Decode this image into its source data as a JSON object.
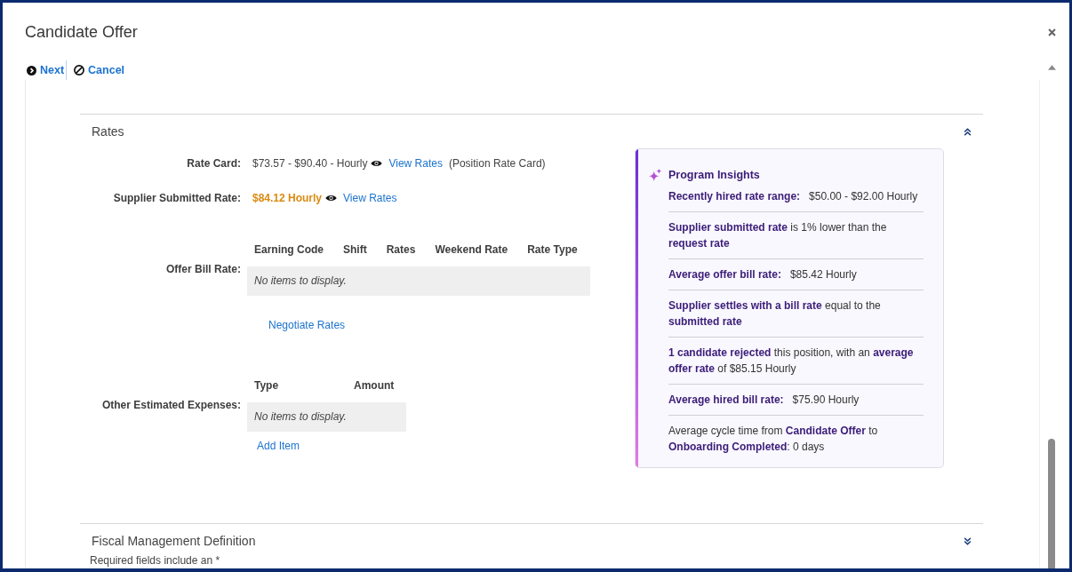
{
  "dialog": {
    "title": "Candidate Offer"
  },
  "toolbar": [
    {
      "kind": "next",
      "label": "Next"
    },
    {
      "kind": "cancel",
      "label": "Cancel"
    }
  ],
  "sections": [
    {
      "title": "Rates",
      "expanded": true,
      "fields": [
        {
          "kind": "rate",
          "label": "Rate Card:",
          "value": "$73.57 - $90.40 - Hourly",
          "highlighted": false,
          "link": "View Rates",
          "note": "(Position Rate Card)"
        },
        {
          "kind": "rate",
          "label": "Supplier Submitted Rate:",
          "value": "$84.12 Hourly",
          "highlighted": true,
          "link": "View Rates"
        },
        {
          "kind": "rate_table",
          "label": "Offer Bill Rate:",
          "columns": [
            "Earning Code",
            "Shift",
            "Rates",
            "Weekend Rate",
            "Rate Type"
          ],
          "empty_text": "No items to display.",
          "action": "Negotiate Rates"
        },
        {
          "kind": "expense_table",
          "label": "Other Estimated Expenses:",
          "columns": [
            "Type",
            "Amount"
          ],
          "empty_text": "No items to display.",
          "action": "Add Item"
        }
      ],
      "insights": {
        "title": "Program Insights",
        "items": [
          "**Recently hired rate range:**   $50.00 - $92.00 Hourly",
          "**Supplier submitted rate** is 1% lower than the **request rate**",
          "**Average offer bill rate:**   $85.42 Hourly",
          "**Supplier settles with a bill rate** equal to the **submitted rate**",
          "**1 candidate rejected** this position, with an **average offer rate** of $85.15 Hourly",
          "**Average hired bill rate:**   $75.90 Hourly",
          "Average cycle time from **Candidate Offer** to **Onboarding Completed**: 0 days"
        ]
      }
    },
    {
      "title": "Fiscal Management Definition",
      "expanded": false,
      "note": "Required fields include an *"
    }
  ]
}
